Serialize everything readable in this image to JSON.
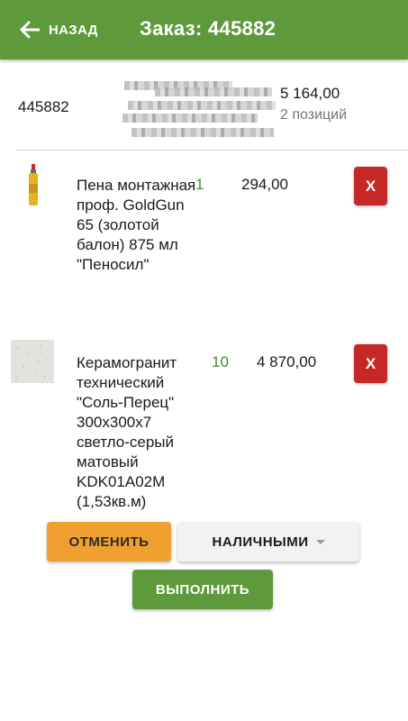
{
  "header": {
    "back_label": "НАЗАД",
    "title": "Заказ: 445882"
  },
  "summary": {
    "order_number": "445882",
    "total": "5 164,00",
    "positions": "2 позиций"
  },
  "items": [
    {
      "name": "Пена монтажная проф. GoldGun 65 (золотой балон) 875 мл \"Пеносил\"",
      "qty": "1",
      "price": "294,00",
      "delete_label": "X"
    },
    {
      "name": "Керамогранит технический \"Соль-Перец\" 300x300x7 светло-серый матовый KDK01A02M (1,53кв.м)",
      "qty": "10",
      "price": "4 870,00",
      "delete_label": "X"
    }
  ],
  "actions": {
    "cancel_label": "ОТМЕНИТЬ",
    "payment_label": "НАЛИЧНЫМИ",
    "complete_label": "ВЫПОЛНИТЬ"
  },
  "colors": {
    "primary": "#5e9a3b",
    "danger": "#c62828",
    "warning": "#f0a030"
  }
}
